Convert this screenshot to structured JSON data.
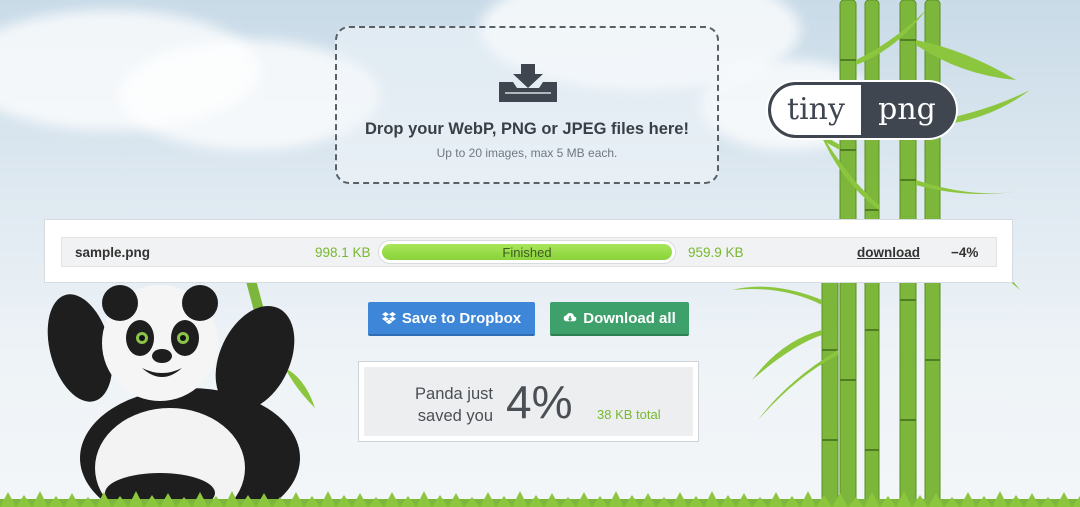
{
  "dropzone": {
    "icon": "download-tray-icon",
    "title": "Drop your WebP, PNG or JPEG files here!",
    "subtitle": "Up to 20 images, max 5 MB each."
  },
  "logo": {
    "left": "tiny",
    "right": "png"
  },
  "files": [
    {
      "name": "sample.png",
      "original_size": "998.1 KB",
      "status": "Finished",
      "progress": 1.0,
      "compressed_size": "959.9 KB",
      "download_label": "download",
      "savings": "−4%"
    }
  ],
  "actions": {
    "dropbox_label": "Save to Dropbox",
    "download_all_label": "Download all"
  },
  "summary": {
    "message": "Panda just saved you",
    "percent": "4%",
    "total": "38 KB total"
  },
  "colors": {
    "accent_green": "#78b832",
    "progress_green": "#9adc48",
    "dropbox_blue": "#3e86d8",
    "download_green": "#3ea06b",
    "logo_dark": "#3f4650"
  }
}
